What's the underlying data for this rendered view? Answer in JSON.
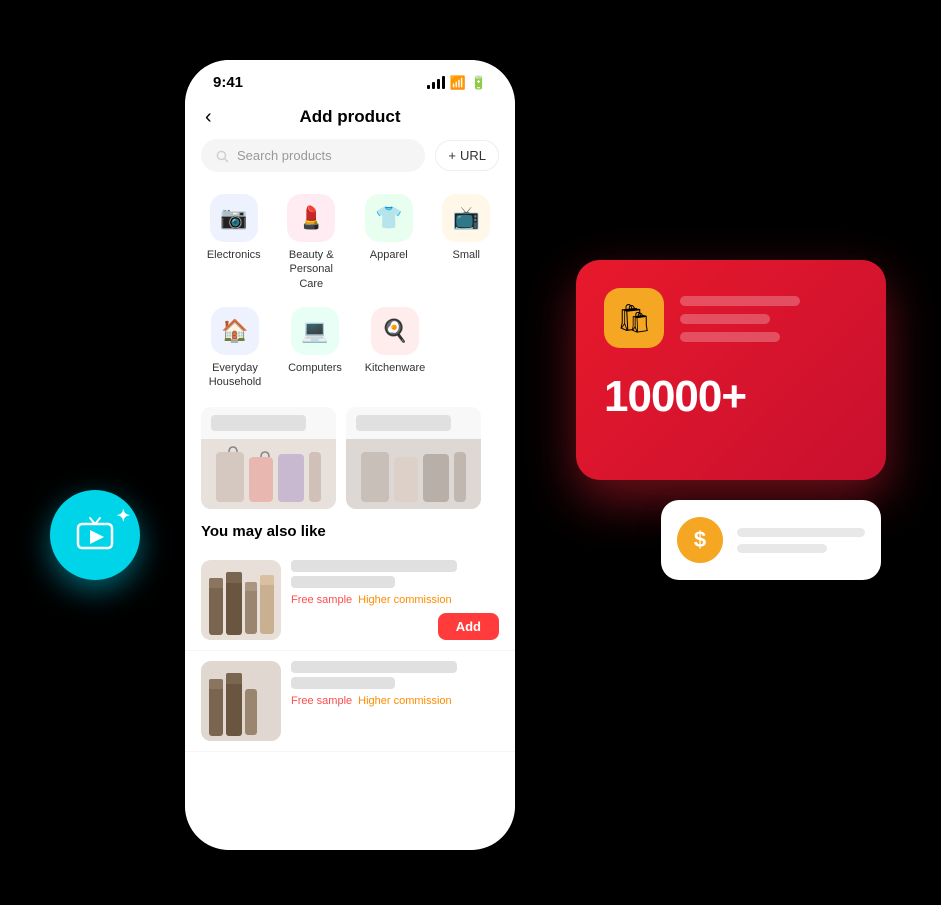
{
  "status": {
    "time": "9:41",
    "wifi": true,
    "battery": true
  },
  "header": {
    "title": "Add product",
    "back_label": "‹"
  },
  "search": {
    "placeholder": "Search products",
    "url_label": "+ URL"
  },
  "categories": [
    {
      "id": "electronics",
      "label": "Electronics",
      "icon": "📷",
      "bg": "#e8f0ff"
    },
    {
      "id": "beauty",
      "label": "Beauty & Personal Care",
      "icon": "💄",
      "bg": "#ffe8f0"
    },
    {
      "id": "apparel",
      "label": "Apparel",
      "icon": "👕",
      "bg": "#e8fff0"
    },
    {
      "id": "small",
      "label": "Small",
      "icon": "📺",
      "bg": "#fff8e8"
    }
  ],
  "categories2": [
    {
      "id": "household",
      "label": "Everyday Household",
      "icon": "🏠",
      "bg": "#e8f0ff"
    },
    {
      "id": "computers",
      "label": "Computers",
      "icon": "💻",
      "bg": "#e8fff5"
    },
    {
      "id": "kitchenware",
      "label": "Kitchenware",
      "icon": "🍳",
      "bg": "#ffe8e8"
    }
  ],
  "section": {
    "you_may_like": "You may also like"
  },
  "products": [
    {
      "id": 1,
      "free_sample": "Free sample",
      "higher_commission": "Higher commission",
      "add_label": "Add"
    },
    {
      "id": 2,
      "free_sample": "Free sample",
      "higher_commission": "Higher commission"
    }
  ],
  "red_card": {
    "number": "10000+",
    "icon": "🛍"
  },
  "white_card": {
    "icon": "$"
  },
  "cyan_circle": {
    "play_icon": "▶"
  }
}
